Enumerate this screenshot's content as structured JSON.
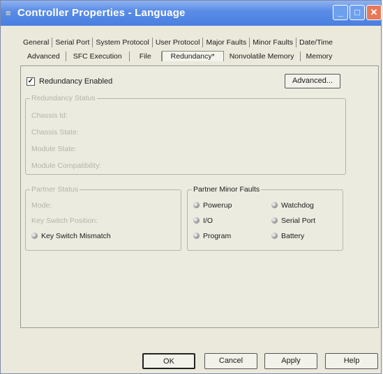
{
  "window": {
    "title": "Controller Properties - Language"
  },
  "tabs_row1": [
    "General",
    "Serial Port",
    "System Protocol",
    "User Protocol",
    "Major Faults",
    "Minor Faults",
    "Date/Time"
  ],
  "tabs_row2": [
    "Advanced",
    "SFC Execution",
    "File",
    "Redundancy*",
    "Nonvolatile Memory",
    "Memory"
  ],
  "active_tab": "Redundancy*",
  "redundancy_enabled": {
    "label": "Redundancy Enabled",
    "checked": true
  },
  "advanced_button": "Advanced...",
  "redundancy_status": {
    "title": "Redundancy Status",
    "items": [
      "Chassis Id:",
      "Chassis State:",
      "Module State:",
      "Module Compatibility:"
    ]
  },
  "partner_status": {
    "title": "Partner Status",
    "items": [
      "Mode:",
      "Key Switch Position:"
    ],
    "key_switch_mismatch": "Key Switch Mismatch"
  },
  "partner_minor_faults": {
    "title": "Partner Minor Faults",
    "col1": [
      "Powerup",
      "I/O",
      "Program"
    ],
    "col2": [
      "Watchdog",
      "Serial Port",
      "Battery"
    ]
  },
  "buttons": {
    "ok": "OK",
    "cancel": "Cancel",
    "apply": "Apply",
    "help": "Help"
  }
}
